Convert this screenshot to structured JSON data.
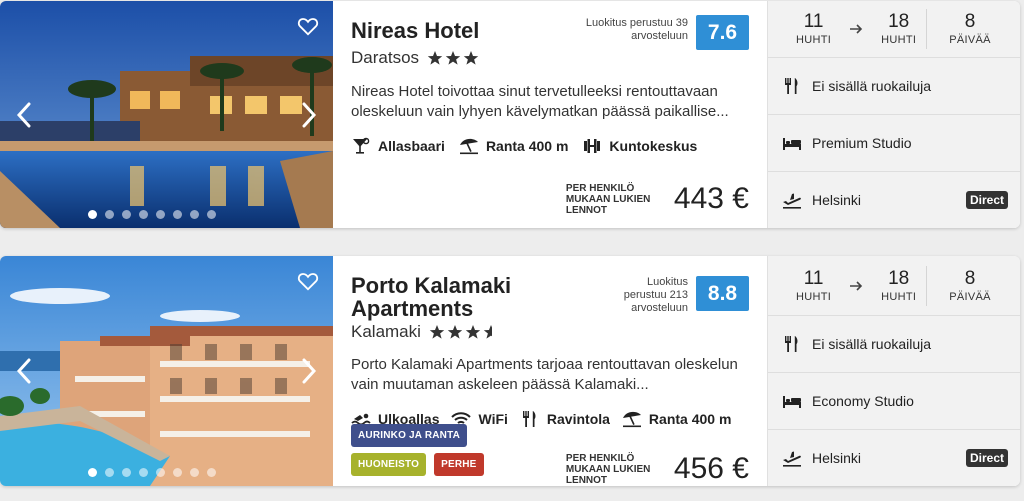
{
  "hotels": [
    {
      "name": "Nireas Hotel",
      "location": "Daratsos",
      "stars": 3,
      "rating_text": "Luokitus perustuu 39 arvosteluun",
      "rating": "7.6",
      "description": "Nireas Hotel toivottaa sinut tervetulleeksi rentouttavaan oleskeluun vain lyhyen kävelymatkan päässä paikallise...",
      "amenities": [
        {
          "icon": "cocktail-icon",
          "label": "Allasbaari"
        },
        {
          "icon": "beach-umbrella-icon",
          "label": "Ranta 400 m"
        },
        {
          "icon": "dumbbell-icon",
          "label": "Kuntokeskus"
        }
      ],
      "tags": [],
      "price_label": "PER HENKILÖ MUKAAN LUKIEN LENNOT",
      "price": "443 €",
      "photo_count": 8,
      "active_photo": 0,
      "departure_day": "11",
      "departure_month": "HUHTI",
      "return_day": "18",
      "return_month": "HUHTI",
      "nights": "8",
      "nights_label": "PÄIVÄÄ",
      "board": "Ei sisällä ruokailuja",
      "room": "Premium Studio",
      "departure_city": "Helsinki",
      "flight_type": "Direct"
    },
    {
      "name": "Porto Kalamaki Apartments",
      "location": "Kalamaki",
      "stars": 3.5,
      "rating_text": "Luokitus perustuu 213 arvosteluun",
      "rating": "8.8",
      "description": "Porto Kalamaki Apartments tarjoaa rentouttavan oleskelun vain muutaman askeleen päässä Kalamaki...",
      "amenities": [
        {
          "icon": "swimming-icon",
          "label": "Ulkoallas"
        },
        {
          "icon": "wifi-icon",
          "label": "WiFi"
        },
        {
          "icon": "fork-knife-icon",
          "label": "Ravintola"
        },
        {
          "icon": "beach-umbrella-icon",
          "label": "Ranta 400 m"
        }
      ],
      "tags": [
        [
          {
            "label": "AURINKO JA RANTA",
            "color": "#3f4f8c"
          }
        ],
        [
          {
            "label": "HUONEISTO",
            "color": "#a7b22c"
          },
          {
            "label": "PERHE",
            "color": "#c0392b"
          }
        ]
      ],
      "price_label": "PER HENKILÖ MUKAAN LUKIEN LENNOT",
      "price": "456 €",
      "photo_count": 8,
      "active_photo": 0,
      "departure_day": "11",
      "departure_month": "HUHTI",
      "return_day": "18",
      "return_month": "HUHTI",
      "nights": "8",
      "nights_label": "PÄIVÄÄ",
      "board": "Ei sisällä ruokailuja",
      "room": "Economy Studio",
      "departure_city": "Helsinki",
      "flight_type": "Direct"
    }
  ],
  "colors": {
    "rating_bg": "#2f8fd6",
    "side_bg": "#f2f2f2",
    "direct_bg": "#333333"
  }
}
